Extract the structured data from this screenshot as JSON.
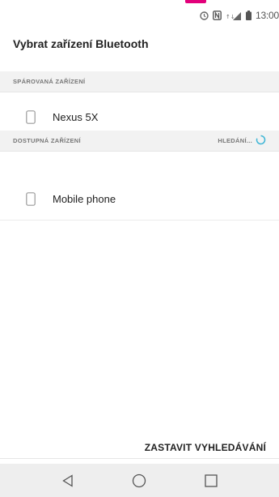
{
  "status_bar": {
    "time": "13:00",
    "icons": [
      "alarm-icon",
      "nfc-icon",
      "signal-icon",
      "battery-icon"
    ]
  },
  "header": {
    "title": "Vybrat zařízení Bluetooth"
  },
  "paired_section": {
    "label": "SPÁROVANÁ ZAŘÍZENÍ",
    "devices": [
      {
        "name": "Nexus 5X",
        "icon": "phone-icon"
      }
    ]
  },
  "available_section": {
    "label": "DOSTUPNÁ ZAŘÍZENÍ",
    "status": "HLEDÁNÍ...",
    "devices": [
      {
        "name": "Mobile phone",
        "icon": "phone-icon"
      }
    ]
  },
  "actions": {
    "stop_scan": "ZASTAVIT VYHLEDÁVÁNÍ"
  },
  "colors": {
    "accent": "#e2007a",
    "spinner": "#3fb6d6",
    "nav_bg": "#eeeeee",
    "section_bg": "#f2f2f2"
  },
  "navigation": [
    "back-icon",
    "home-icon",
    "recents-icon"
  ]
}
